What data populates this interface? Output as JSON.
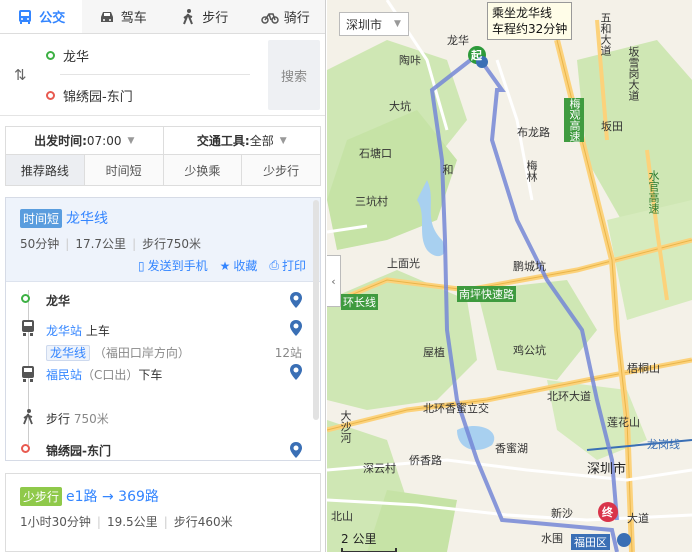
{
  "modes": [
    {
      "label": "公交",
      "icon": "bus-icon",
      "active": true
    },
    {
      "label": "驾车",
      "icon": "car-icon",
      "active": false
    },
    {
      "label": "步行",
      "icon": "walk-icon",
      "active": false
    },
    {
      "label": "骑行",
      "icon": "bike-icon",
      "active": false
    }
  ],
  "inputs": {
    "from": "龙华",
    "to": "锦绣园-东门",
    "search_label": "搜索"
  },
  "options": {
    "depart_label": "出发时间:",
    "depart_value": "07:00",
    "tool_label": "交通工具:",
    "tool_value": "全部",
    "tabs": [
      "推荐路线",
      "时间短",
      "少换乘",
      "少步行"
    ]
  },
  "route1": {
    "tag": "时间短",
    "name": "龙华线",
    "duration": "50分钟",
    "distance": "17.7公里",
    "walk": "步行750米",
    "actions": {
      "send": "发送到手机",
      "fav": "收藏",
      "print": "打印"
    },
    "steps": {
      "origin": "龙华",
      "board_station": "龙华站",
      "board_action": "上车",
      "line_name": "龙华线",
      "line_direction": "（福田口岸方向）",
      "stops": "12站",
      "alight_station": "福民站",
      "alight_exit": "（C口出）",
      "alight_action": "下车",
      "walk_label": "步行",
      "walk_dist": "750米",
      "destination": "锦绣园-东门"
    }
  },
  "route2": {
    "tag": "少步行",
    "name": "e1路 → 369路",
    "duration": "1小时30分钟",
    "distance": "19.5公里",
    "walk": "步行460米"
  },
  "map": {
    "city": "深圳市",
    "tooltip_line1": "乘坐龙华线",
    "tooltip_line2": "车程约32分钟",
    "start_marker": "起",
    "end_marker": "终",
    "scale": "2 公里",
    "labels": {
      "longhua": "龙华",
      "taolu": "陶咔",
      "dakan": "大坑",
      "shitang": "石塘口",
      "sankeng": "三坑村",
      "shangmian": "上面光",
      "huanlian": "环长线",
      "wuhe": "五和大道",
      "bantian": "坂田",
      "bulong": "布龙路",
      "meiguan": "梅观高速",
      "nanping": "南坪快速路",
      "jiban": "坂雪岗大道",
      "wutong": "梧桐山",
      "tanghu": "鸡公坑",
      "beihuan": "北环香蜜立交",
      "beihuan2": "北环大道",
      "xiangmi": "香蜜湖",
      "shenzhen": "深圳市",
      "futian": "福田区",
      "lianhua": "莲花山",
      "longgang": "龙岗线",
      "qiaoxiang": "侨香路",
      "dashahe": "大沙河",
      "xinsha": "新沙",
      "beishan": "北山",
      "dadao": "大道",
      "shuiwei": "水围",
      "xili": "深云村",
      "wufeng": "屋植",
      "jiefang": "梅林",
      "hebei": "和",
      "shanshui": "水官高速",
      "liantang": "鹏城坑"
    }
  }
}
